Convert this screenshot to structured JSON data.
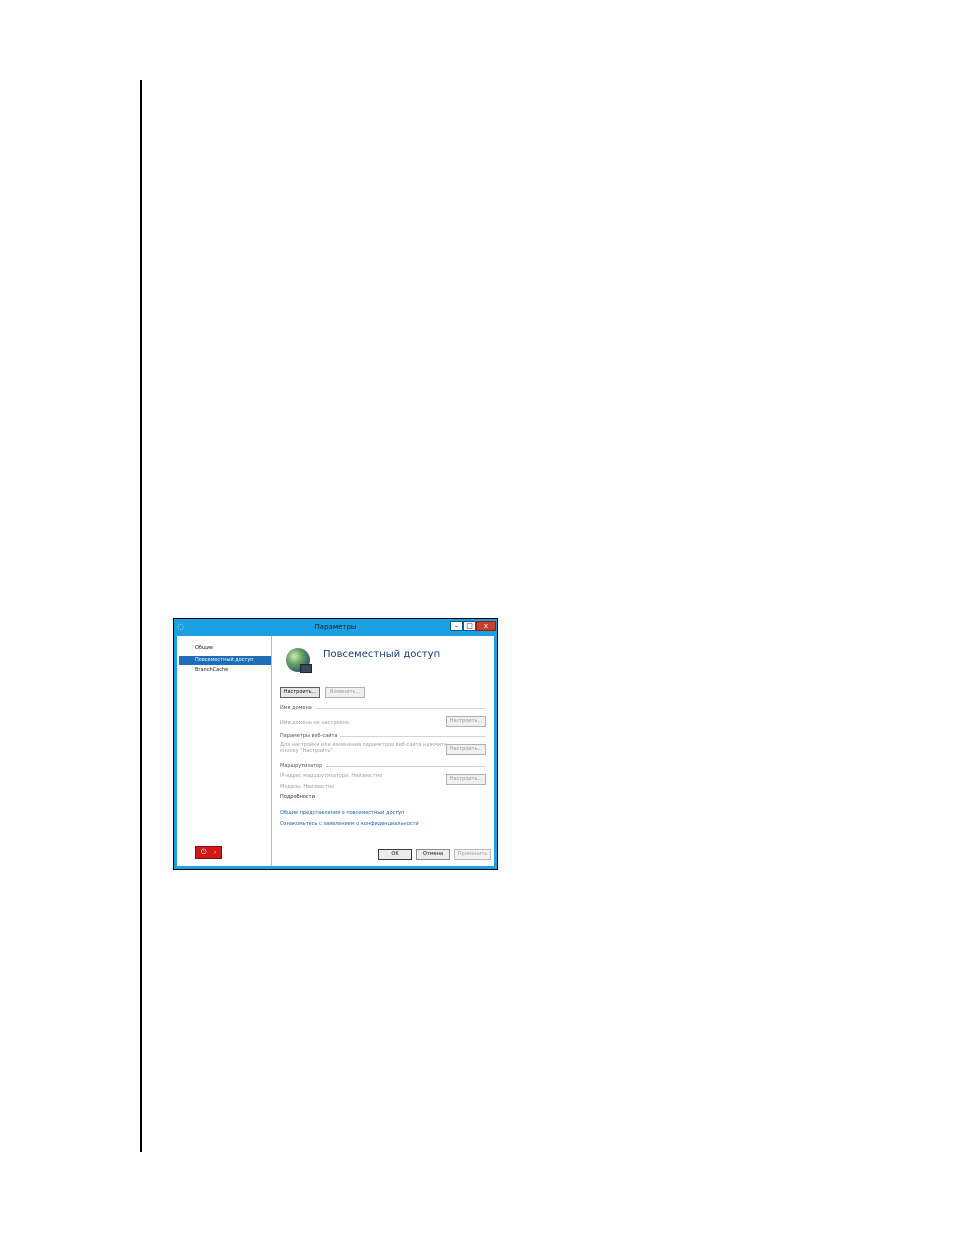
{
  "window": {
    "title": "Параметры",
    "min_glyph": "–",
    "max_glyph": "□",
    "close_glyph": "x"
  },
  "sidebar": {
    "items": [
      {
        "label": "Общие",
        "selected": false
      },
      {
        "label": "Повсеместный доступ",
        "selected": true
      },
      {
        "label": "BranchCache",
        "selected": false
      }
    ]
  },
  "main": {
    "title": "Повсеместный доступ",
    "configure_button": "Настроить...",
    "change_button": "Изменить...",
    "domain": {
      "heading": "Имя домена",
      "text": "Имя домена не настроено",
      "button": "Настроить..."
    },
    "website": {
      "heading": "Параметры веб-сайта",
      "text_line1": "Для настройки или изменения параметров веб-сайта нажмите",
      "text_line2": "кнопку \"Настроить\".",
      "button": "Настроить..."
    },
    "router": {
      "heading": "Маршрутизатор",
      "ip_text": "IP-адрес маршрутизатора: Неизвестно",
      "model_text": "Модель: Неизвестно",
      "button": "Настроить...",
      "details": "Подробности"
    },
    "links": [
      "Общие представления о повсеместный доступ",
      "Ознакомьтесь с заявлением о конфиденциальности"
    ]
  },
  "footer": {
    "ok": "OK",
    "cancel": "Отмена",
    "apply": "Применить"
  },
  "power": {
    "icon": "power-icon",
    "arrow": "›"
  },
  "colors": {
    "titlebar": "#1ba1e2",
    "selection": "#1f6fb8",
    "close": "#c7402c",
    "power": "#d01818",
    "link": "#1f5fb0"
  }
}
